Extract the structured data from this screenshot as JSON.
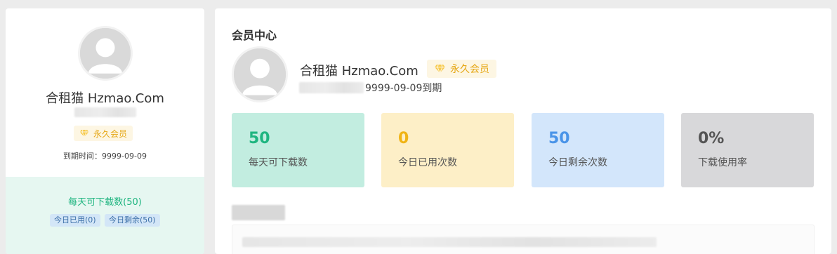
{
  "profile": {
    "name": "合租猫 Hzmao.Com",
    "membership": "永久会员",
    "expiry_label": "到期时间：9999-09-09",
    "expiry_suffix": "9999-09-09到期"
  },
  "left_stats": {
    "daily_text": "每天可下载数(50)",
    "used_pill": "今日已用(0)",
    "remaining_pill": "今日剩余(50)"
  },
  "member_center": {
    "title": "会员中心"
  },
  "cards": [
    {
      "value": "50",
      "label": "每天可下载数",
      "bg": "#c2ede0",
      "color": "#1fb580"
    },
    {
      "value": "0",
      "label": "今日已用次数",
      "bg": "#fdefc7",
      "color": "#f0b416"
    },
    {
      "value": "50",
      "label": "今日剩余次数",
      "bg": "#d3e6fb",
      "color": "#4a94e8"
    },
    {
      "value": "0%",
      "label": "下载使用率",
      "bg": "#d8d8da",
      "color": "#555555"
    }
  ],
  "icons": {
    "avatar": "user-avatar-icon",
    "badge": "diamond-icon"
  },
  "colors": {
    "accent_green": "#1fb580",
    "gold": "#e6a817"
  }
}
